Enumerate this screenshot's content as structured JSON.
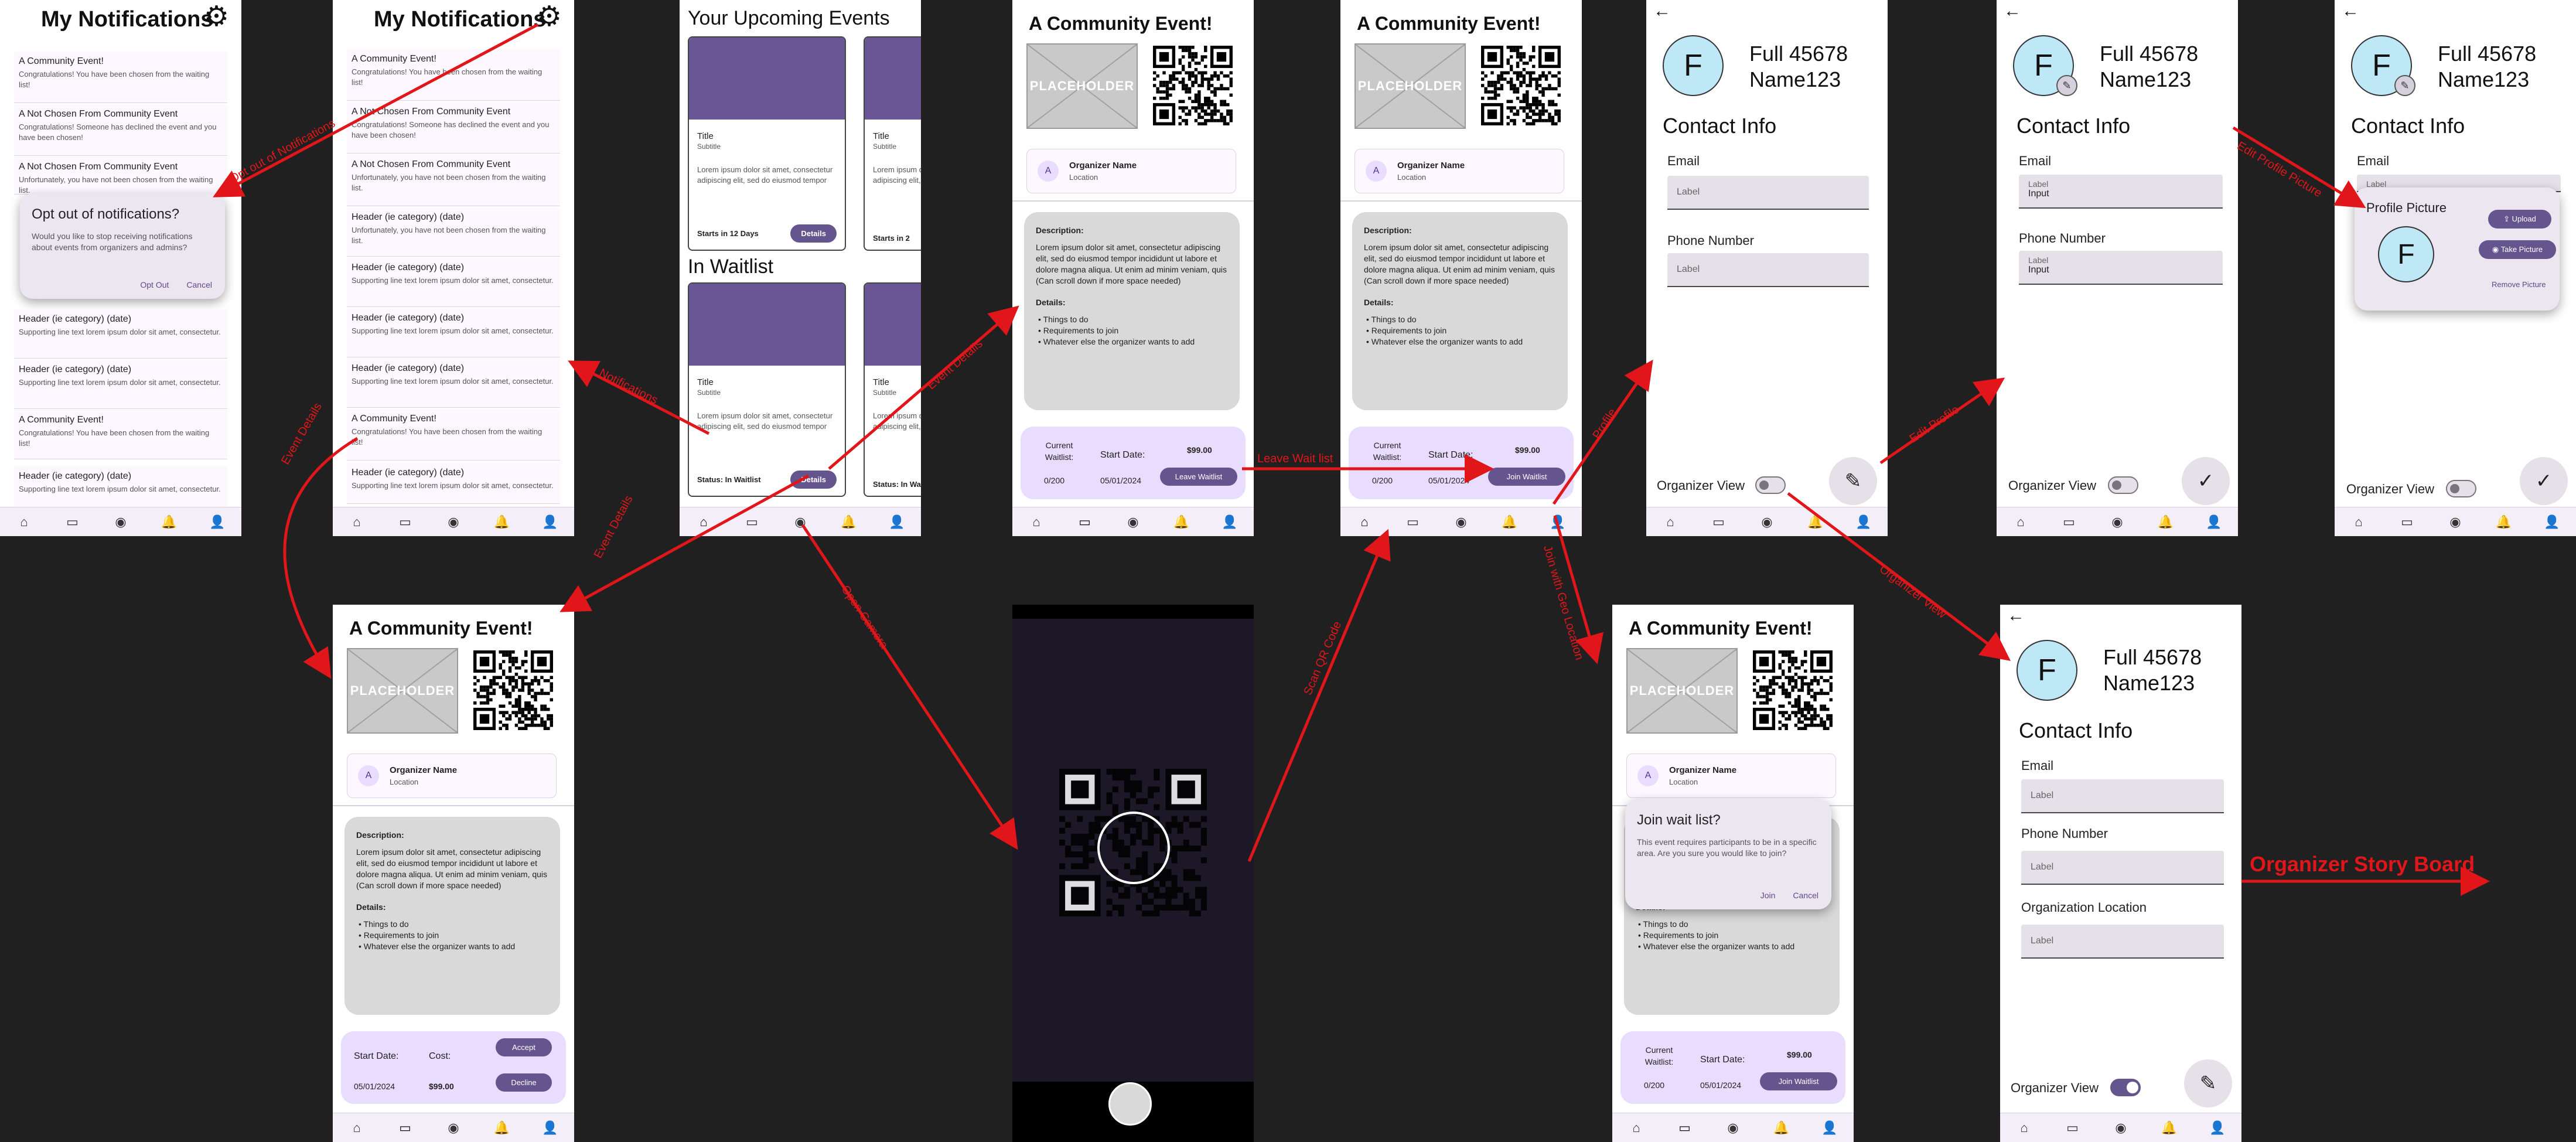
{
  "nav_icons": [
    "home-icon",
    "ticket-icon",
    "camera-icon",
    "bell-icon",
    "person-icon"
  ],
  "notifications_screen": {
    "title": "My Notifications",
    "items": [
      {
        "header": "A Community Event!",
        "body": "Congratulations! You have been chosen from the waiting list!"
      },
      {
        "header": "A Not Chosen From Community Event",
        "body": "Congratulations! Someone has declined the event and you have been chosen!"
      },
      {
        "header": "A Not Chosen From Community Event",
        "body": "Unfortunately, you have not been chosen from the waiting list."
      },
      {
        "header": "Header (ie category) (date)",
        "body": "Unfortunately, you have not been chosen from the waiting list."
      },
      {
        "header": "Header (ie category) (date)",
        "body": "Supporting line text lorem ipsum dolor sit amet, consectetur."
      },
      {
        "header": "Header (ie category) (date)",
        "body": "Supporting line text lorem ipsum dolor sit amet, consectetur."
      },
      {
        "header": "Header (ie category) (date)",
        "body": "Supporting line text lorem ipsum dolor sit amet, consectetur."
      },
      {
        "header": "A Community Event!",
        "body": "Congratulations! You have been chosen from the waiting list!"
      },
      {
        "header": "Header (ie category) (date)",
        "body": "Supporting line text lorem ipsum dolor sit amet, consectetur."
      }
    ],
    "dialog": {
      "title": "Opt out of notifications?",
      "body": "Would you like to stop receiving notifications about events from organizers and admins?",
      "confirm": "Opt Out",
      "cancel": "Cancel"
    }
  },
  "events_screen": {
    "upcoming_title": "Your Upcoming Events",
    "waitlist_title": "In Waitlist",
    "card_title": "Title",
    "card_subtitle": "Subtitle",
    "card_body": "Lorem ipsum dolor sit amet, consectetur adipiscing elit, sed do eiusmod tempor",
    "upcoming_status": "Starts in 12 Days",
    "upcoming_status_partial": "Starts in 2",
    "waitlist_status": "Status: In Waitlist",
    "waitlist_status_partial": "Status: In Wait",
    "details_button": "Details"
  },
  "event_detail": {
    "title": "A Community Event!",
    "placeholder": "PLACEHOLDER",
    "avatar_letter": "A",
    "organizer_name": "Organizer Name",
    "organizer_location": "Location",
    "desc_heading": "Description:",
    "desc_body": "Lorem ipsum dolor sit amet, consectetur adipiscing elit, sed do eiusmod tempor incididunt ut labore et dolore magna aliqua. Ut enim ad minim veniam, quis",
    "desc_note": "(Can scroll down if more space needed)",
    "details_heading": "Details:",
    "details": [
      "Things to do",
      "Requirements to join",
      "Whatever else the organizer wants to add"
    ],
    "current_waitlist_label": "Current Waitlist:",
    "current_waitlist_value": "0/200",
    "start_date_label": "Start Date:",
    "start_date_value": "05/01/2024",
    "price": "$99.00",
    "cost_label": "Cost:",
    "leave_waitlist": "Leave Waitlist",
    "join_waitlist": "Join Waitlist",
    "accept": "Accept",
    "decline": "Decline",
    "join_dialog": {
      "title": "Join wait list?",
      "body": "This event requires participants to be in a specific area. Are you sure you would like to join?",
      "confirm": "Join",
      "cancel": "Cancel"
    }
  },
  "profile": {
    "initial": "F",
    "name": "Full 45678 Name123",
    "contact_heading": "Contact Info",
    "email_label": "Email",
    "phone_label": "Phone Number",
    "org_location_label": "Organization Location",
    "field_label": "Label",
    "field_input": "Input",
    "organizer_view": "Organizer View",
    "picture_dialog": {
      "title": "Profile Picture",
      "upload": "Upload",
      "take_picture": "Take Picture",
      "remove": "Remove Picture"
    }
  },
  "flow_labels": {
    "opt_out": "Opt out of Notifications",
    "notifications": "Notifications",
    "event_details_1": "Event Details",
    "event_details_2": "Event Details",
    "event_details_3": "Event Details",
    "leave_wait_list": "Leave Wait list",
    "profile": "Profile",
    "edit_profile": "Edit Profile",
    "edit_profile_picture": "Edit Profile Picture",
    "open_camera": "Open Camera",
    "scan_qr": "Scan QR Code",
    "join_geo": "Join with Geo Location",
    "organizer_view": "Organizer View",
    "organizer_story_board": "Organizer Story Board"
  },
  "colors": {
    "background": "#202020",
    "accent": "#65558f",
    "arrow": "#e0161a",
    "card_image": "#6a5694",
    "footer": "#e8dcff",
    "avatar": "#bfe8f6"
  }
}
